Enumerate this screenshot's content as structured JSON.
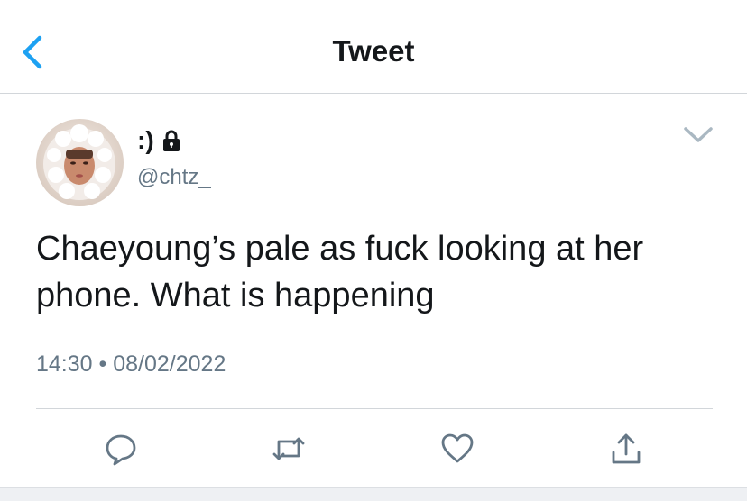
{
  "header": {
    "title": "Tweet"
  },
  "tweet": {
    "display_name": ":)",
    "handle": "@chtz_",
    "text_lines": [
      "Chaeyoung’s pale as fuck looking at her",
      "phone. What is happening"
    ],
    "time": "14:30",
    "separator": "•",
    "date": "08/02/2022"
  },
  "icons": {
    "back": "chevron-left-icon",
    "protected": "lock-icon",
    "more": "chevron-down-icon",
    "reply": "reply-icon",
    "retweet": "retweet-icon",
    "like": "heart-icon",
    "share": "share-icon"
  },
  "colors": {
    "accent": "#1da1f2",
    "text": "#14171a",
    "secondary": "#657786",
    "icon_gray": "#657786",
    "divider": "#d2d6da"
  }
}
